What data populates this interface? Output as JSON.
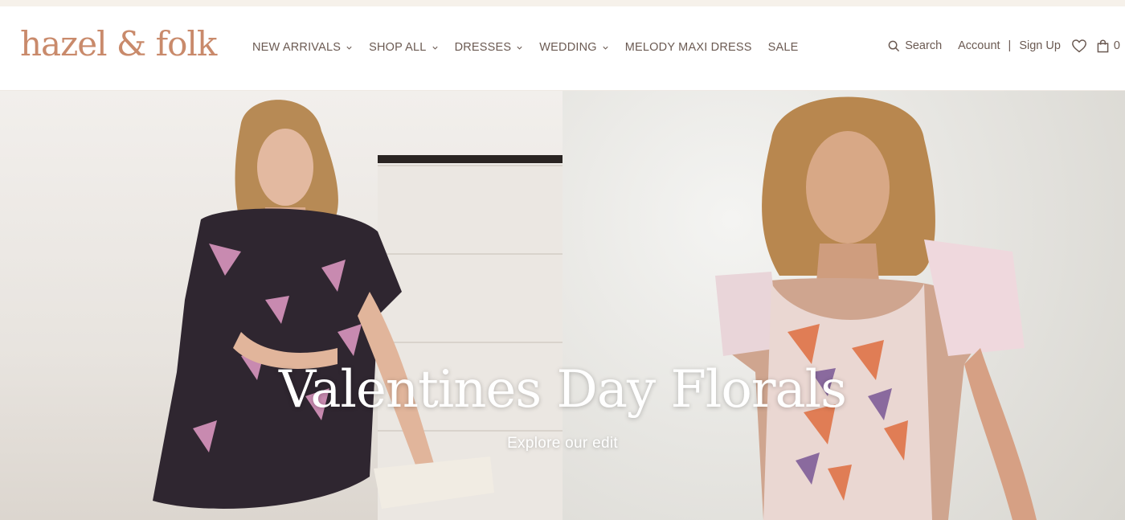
{
  "brand": {
    "logo_text": "hazel & folk",
    "color": "#c98a6b"
  },
  "nav": {
    "items": [
      {
        "label": "NEW ARRIVALS",
        "has_dropdown": true
      },
      {
        "label": "SHOP ALL",
        "has_dropdown": true
      },
      {
        "label": "DRESSES",
        "has_dropdown": true
      },
      {
        "label": "WEDDING",
        "has_dropdown": true
      },
      {
        "label": "MELODY MAXI DRESS",
        "has_dropdown": false
      },
      {
        "label": "SALE",
        "has_dropdown": false
      }
    ]
  },
  "header_right": {
    "search_label": "Search",
    "account_label": "Account",
    "divider": "|",
    "signup_label": "Sign Up",
    "cart_count": "0",
    "icons": [
      "search-icon",
      "heart-icon",
      "shopping-bag-icon"
    ]
  },
  "hero": {
    "title": "Valentines Day Florals",
    "cta": "Explore our edit"
  },
  "colors": {
    "text": "#6b5a52",
    "announcement_bar": "#f6f1ea",
    "hero_text": "#ffffff"
  }
}
